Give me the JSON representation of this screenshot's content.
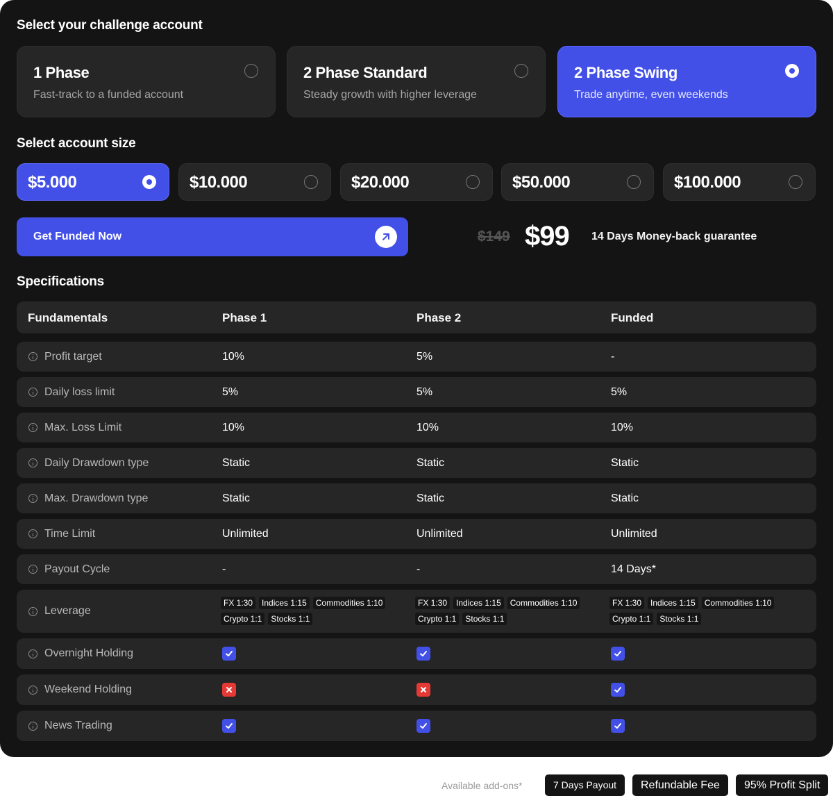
{
  "challenge": {
    "heading": "Select your challenge account",
    "options": [
      {
        "title": "1 Phase",
        "subtitle": "Fast-track to a funded account",
        "selected": false
      },
      {
        "title": "2 Phase Standard",
        "subtitle": "Steady growth with higher leverage",
        "selected": false
      },
      {
        "title": "2 Phase Swing",
        "subtitle": "Trade anytime, even weekends",
        "selected": true
      }
    ]
  },
  "size": {
    "heading": "Select account size",
    "options": [
      {
        "value": "$5.000",
        "selected": true
      },
      {
        "value": "$10.000",
        "selected": false
      },
      {
        "value": "$20.000",
        "selected": false
      },
      {
        "value": "$50.000",
        "selected": false
      },
      {
        "value": "$100.000",
        "selected": false
      }
    ]
  },
  "cta": {
    "label": "Get Funded Now",
    "icon": "arrow-up-right-icon"
  },
  "pricing": {
    "old_price": "$149",
    "price": "$99",
    "guarantee": "14 Days Money-back guarantee"
  },
  "specs": {
    "heading": "Specifications",
    "columns": [
      "Fundamentals",
      "Phase 1",
      "Phase 2",
      "Funded"
    ],
    "rows": [
      {
        "label": "Profit target",
        "values": [
          "10%",
          "5%",
          "-"
        ]
      },
      {
        "label": "Daily loss limit",
        "values": [
          "5%",
          "5%",
          "5%"
        ]
      },
      {
        "label": "Max. Loss Limit",
        "values": [
          "10%",
          "10%",
          "10%"
        ]
      },
      {
        "label": "Daily Drawdown type",
        "values": [
          "Static",
          "Static",
          "Static"
        ]
      },
      {
        "label": "Max. Drawdown type",
        "values": [
          "Static",
          "Static",
          "Static"
        ]
      },
      {
        "label": "Time Limit",
        "values": [
          "Unlimited",
          "Unlimited",
          "Unlimited"
        ]
      },
      {
        "label": "Payout Cycle",
        "values": [
          "-",
          "-",
          "14 Days*"
        ]
      }
    ],
    "leverage": {
      "label": "Leverage",
      "chips": [
        "FX 1:30",
        "Indices 1:15",
        "Commodities 1:10",
        "Crypto 1:1",
        "Stocks 1:1"
      ]
    },
    "checks": [
      {
        "label": "Overnight Holding",
        "values": [
          true,
          true,
          true
        ]
      },
      {
        "label": "Weekend Holding",
        "values": [
          false,
          false,
          true
        ]
      },
      {
        "label": "News Trading",
        "values": [
          true,
          true,
          true
        ]
      }
    ]
  },
  "addons": {
    "label": "Available add-ons*",
    "items": [
      "7 Days Payout",
      "Refundable Fee",
      "95% Profit Split"
    ]
  },
  "colors": {
    "accent": "#4350e8",
    "panel": "#141414",
    "card": "#262626",
    "deny": "#e53935"
  }
}
